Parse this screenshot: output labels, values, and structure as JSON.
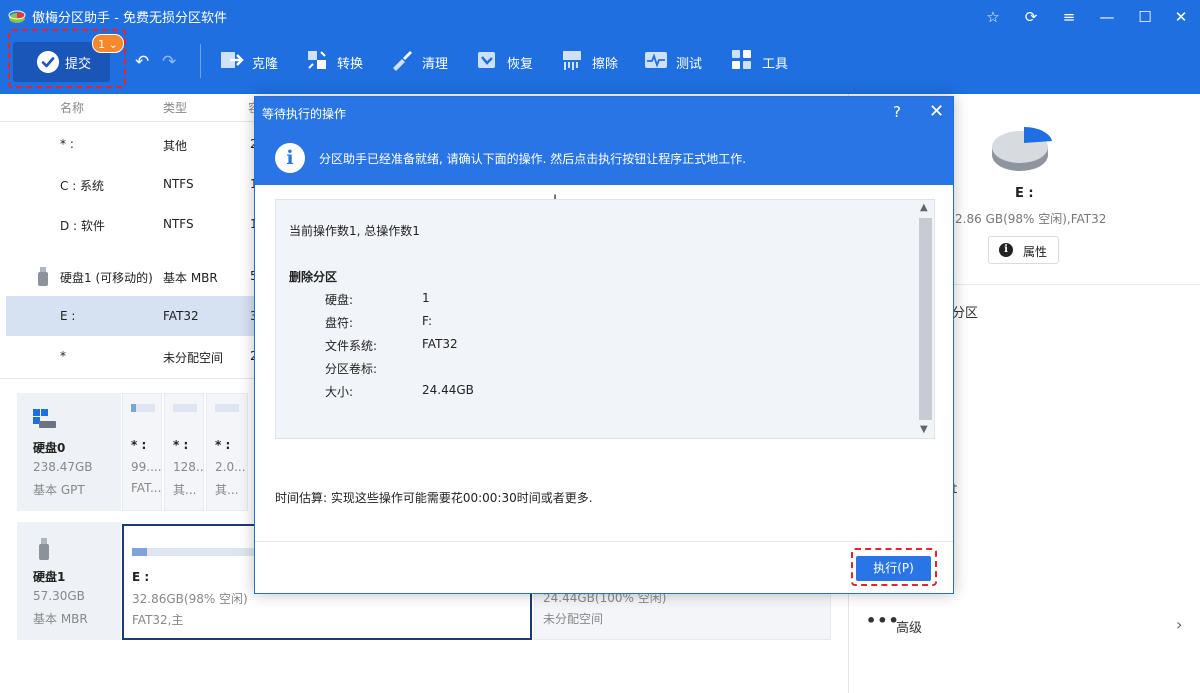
{
  "app": {
    "title": "傲梅分区助手 - 免费无损分区软件"
  },
  "window_controls": [
    "star-icon",
    "refresh-icon",
    "menu-icon",
    "minimize-icon",
    "maximize-icon",
    "close-icon"
  ],
  "toolbar": {
    "submit_label": "提交",
    "badge": "1",
    "items": [
      {
        "label": "克隆",
        "icon": "clone-icon"
      },
      {
        "label": "转换",
        "icon": "convert-icon"
      },
      {
        "label": "清理",
        "icon": "clean-icon"
      },
      {
        "label": "恢复",
        "icon": "recover-icon"
      },
      {
        "label": "擦除",
        "icon": "wipe-icon"
      },
      {
        "label": "测试",
        "icon": "test-icon"
      },
      {
        "label": "工具",
        "icon": "tools-icon"
      }
    ]
  },
  "table": {
    "headers": [
      "名称",
      "类型",
      "容"
    ],
    "rows": [
      {
        "name": "* :",
        "type": "其他",
        "cap": "2"
      },
      {
        "name": "C : 系统",
        "type": "NTFS",
        "cap": "1"
      },
      {
        "name": "D : 软件",
        "type": "NTFS",
        "cap": "1"
      },
      {
        "name": "硬盘1 (可移动的)",
        "type": "基本 MBR",
        "cap": "5"
      },
      {
        "name": "E :",
        "type": "FAT32",
        "cap": "3"
      },
      {
        "name": "*",
        "type": "未分配空间",
        "cap": "2"
      }
    ]
  },
  "disk0": {
    "name": "硬盘0",
    "size": "238.47GB",
    "type": "基本 GPT",
    "partitions": [
      {
        "name": "* :",
        "size": "99....",
        "fs": "FAT...",
        "used": 0.2
      },
      {
        "name": "* :",
        "size": "128...",
        "fs": "其...",
        "used": 0.0
      },
      {
        "name": "* :",
        "size": "2.0...",
        "fs": "其...",
        "used": 0.0
      }
    ]
  },
  "disk1": {
    "name": "硬盘1",
    "size": "57.30GB",
    "type": "基本 MBR",
    "partitions": [
      {
        "name": "E :",
        "size": "32.86GB(98% 空闲)",
        "fs": "FAT32,主",
        "used": 0.02
      },
      {
        "name": "",
        "size": "24.44GB(100% 空闲)",
        "fs": "未分配空间",
        "used": 0.0
      }
    ]
  },
  "right_panel": {
    "drive": "E :",
    "size": "2.86 GB(98% 空闲),FAT32",
    "properties_label": "属性",
    "op_label": "分区",
    "op_label2": "t",
    "more_label": "高级"
  },
  "dialog": {
    "title": "等待执行的操作",
    "info": "分区助手已经准备就绪, 请确认下面的操作. 然后点击执行按钮让程序正式地工作.",
    "count": "当前操作数1, 总操作数1",
    "op_title": "删除分区",
    "fields": [
      {
        "k": "硬盘:",
        "v": "1"
      },
      {
        "k": "盘符:",
        "v": "F:"
      },
      {
        "k": "文件系统:",
        "v": "FAT32"
      },
      {
        "k": "分区卷标:",
        "v": ""
      },
      {
        "k": "大小:",
        "v": "24.44GB"
      }
    ],
    "time": "时间估算: 实现这些操作可能需要花00:00:30时间或者更多.",
    "execute_label": "执行(P)"
  },
  "colors": {
    "accent": "#1f6fe0",
    "highlight": "#e8232a",
    "badge": "#f5882b"
  }
}
